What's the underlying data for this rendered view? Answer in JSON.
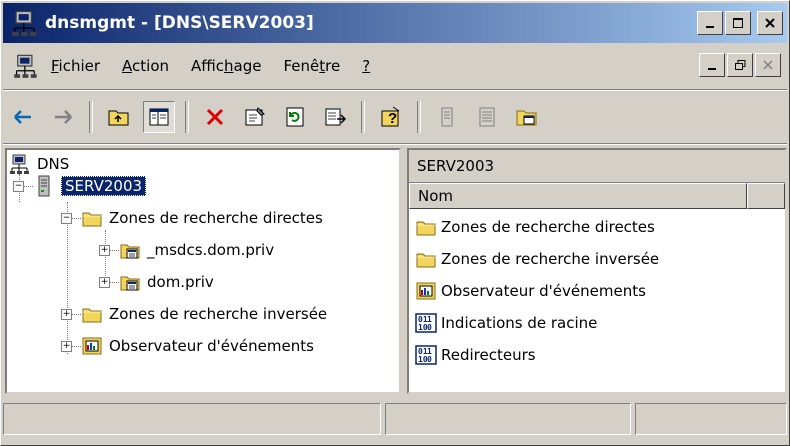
{
  "window": {
    "title": "dnsmgmt - [DNS\\SERV2003]",
    "title_icon": "dns-icon",
    "caption_buttons": [
      "minimize",
      "maximize",
      "close"
    ]
  },
  "menubar": {
    "items": [
      {
        "label": "Fichier",
        "accel": "F",
        "rest": "ichier"
      },
      {
        "label": "Action",
        "accel": "A",
        "rest": "ction"
      },
      {
        "label": "Affichage",
        "pre": "Affic",
        "accel": "h",
        "rest": "age"
      },
      {
        "label": "Fenêtre",
        "pre": "Fenê",
        "accel": "t",
        "rest": "re"
      },
      {
        "label": "?",
        "accel": "?",
        "rest": ""
      }
    ]
  },
  "toolbar": {
    "buttons": [
      "back-arrow-icon",
      "forward-arrow-icon",
      "up-folder-icon",
      "show-tree-icon",
      "delete-icon",
      "properties-icon",
      "refresh-icon",
      "export-list-icon",
      "help-icon",
      "list-icon-1",
      "list-icon-2",
      "new-window-icon"
    ]
  },
  "tree": {
    "root": "DNS",
    "server": "SERV2003",
    "forward_zones": "Zones de recherche directes",
    "zone1": "_msdcs.dom.priv",
    "zone2": "dom.priv",
    "reverse_zones": "Zones de recherche inversée",
    "event_viewer": "Observateur d'événements"
  },
  "right_pane": {
    "title": "SERV2003",
    "column_header": "Nom",
    "items": [
      "Zones de recherche directes",
      "Zones de recherche inversée",
      "Observateur d'événements",
      "Indications de racine",
      "Redirecteurs"
    ]
  },
  "colors": {
    "title_active_start": "#0a246a",
    "title_active_end": "#a6caf0",
    "face": "#d4d0c8",
    "folder": "#f2d55c",
    "selection": "#0a246a"
  }
}
